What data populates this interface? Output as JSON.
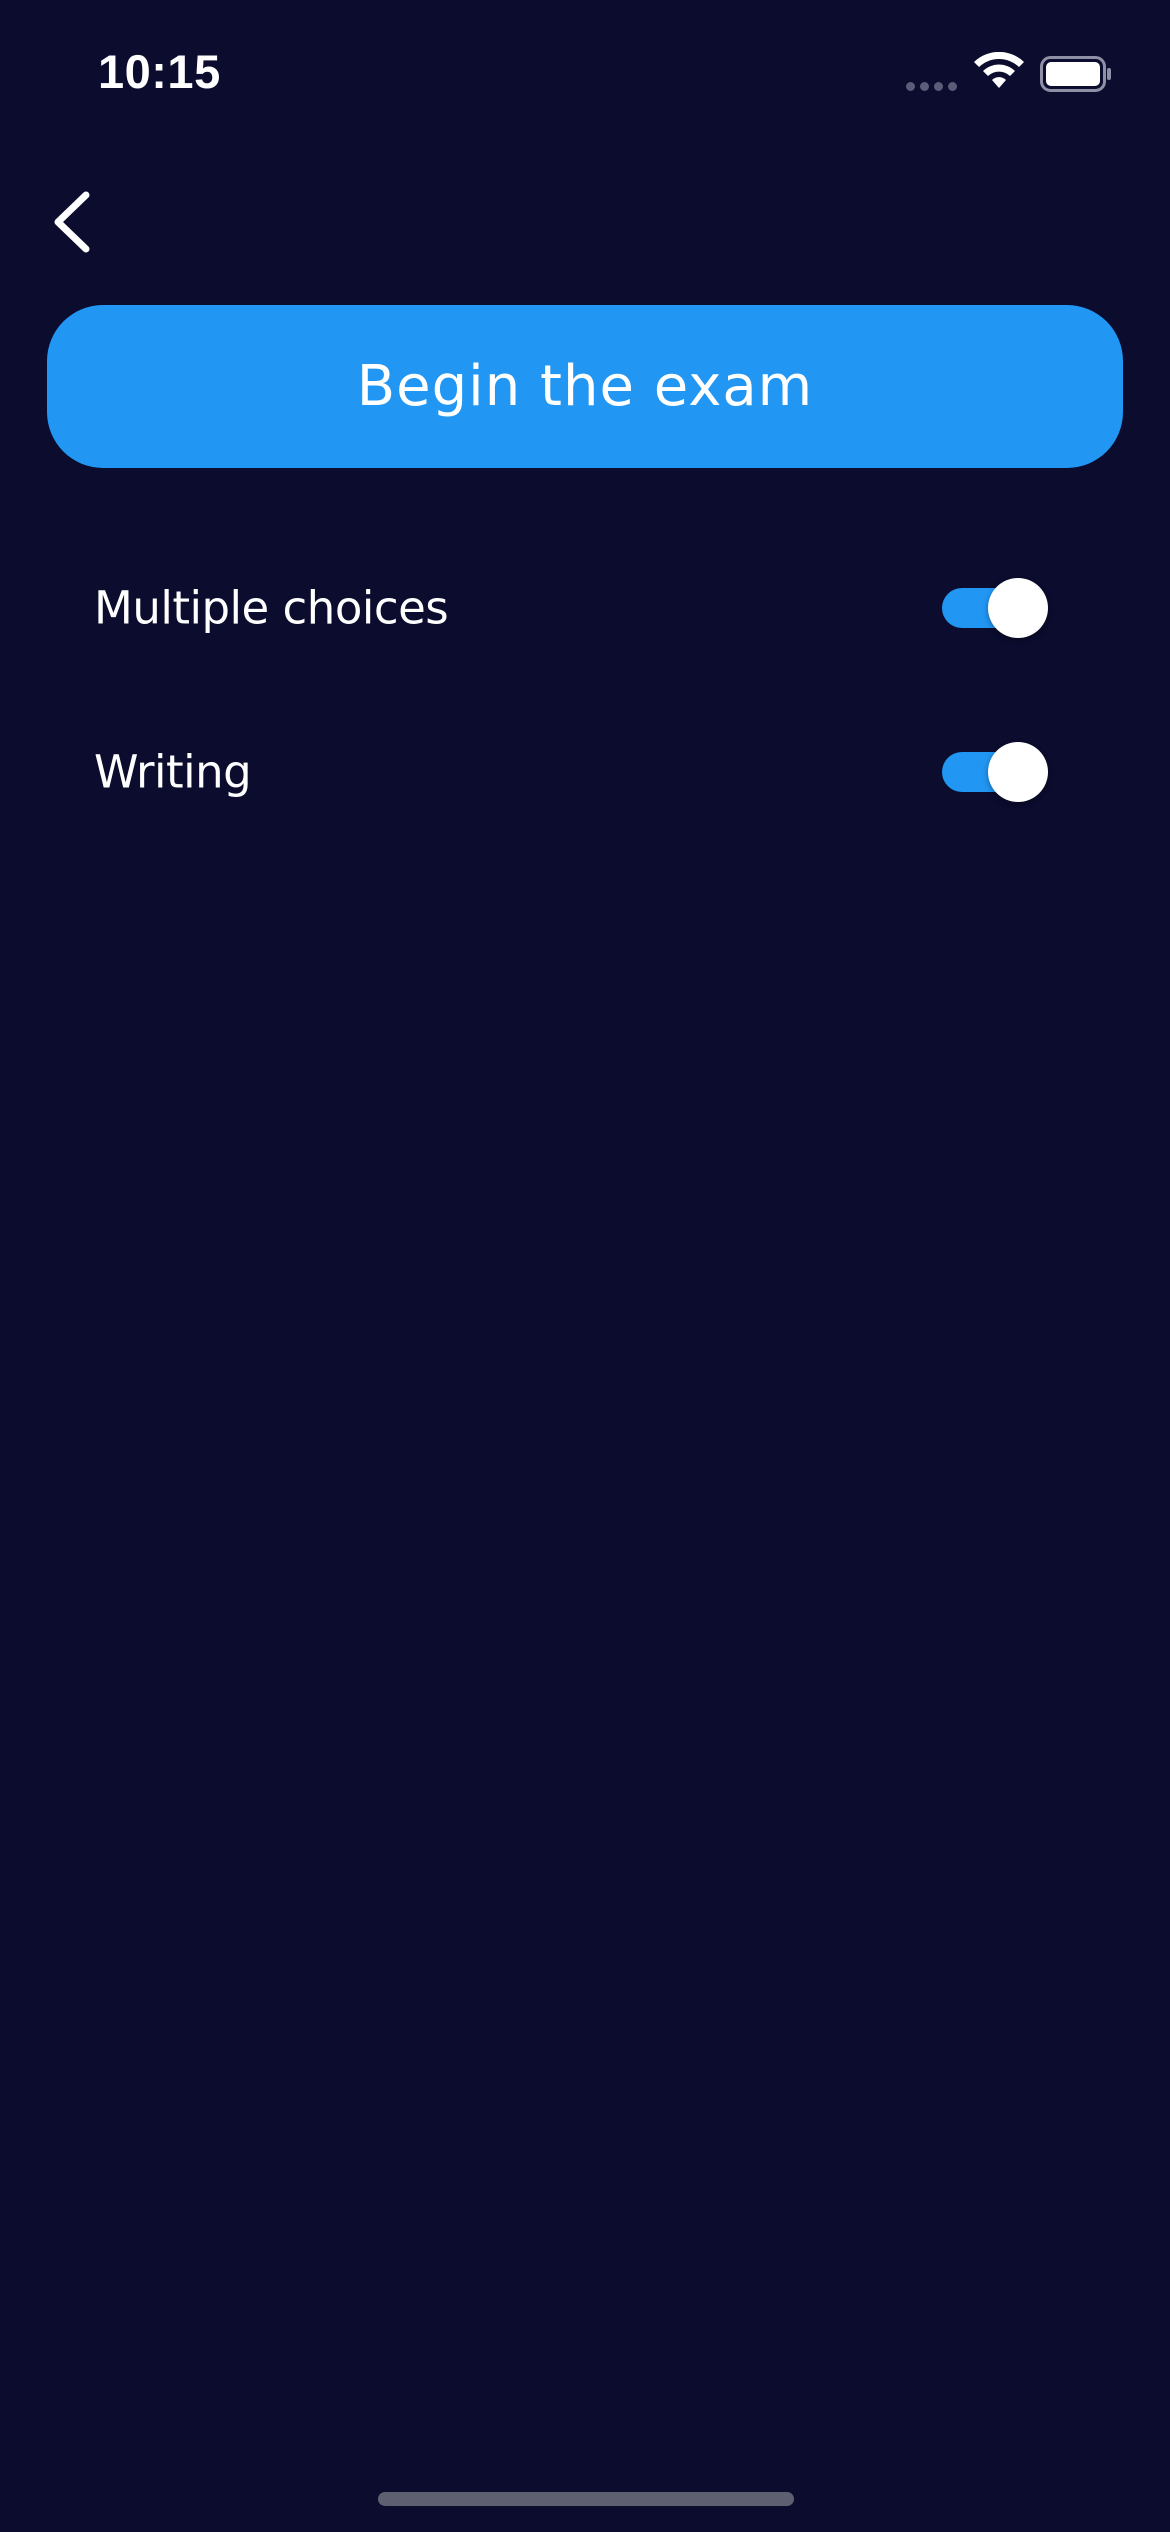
{
  "status_bar": {
    "time": "10:15",
    "signal_icon": "signal-dots-icon",
    "wifi_icon": "wifi-icon",
    "battery_icon": "battery-full-icon"
  },
  "nav": {
    "back_icon": "chevron-left-icon"
  },
  "main": {
    "begin_label": "Begin the exam",
    "options": [
      {
        "label": "Multiple choices",
        "enabled": true
      },
      {
        "label": "Writing",
        "enabled": true
      }
    ]
  },
  "colors": {
    "background": "#0b0c2e",
    "accent": "#2196f3",
    "text": "#ffffff"
  }
}
